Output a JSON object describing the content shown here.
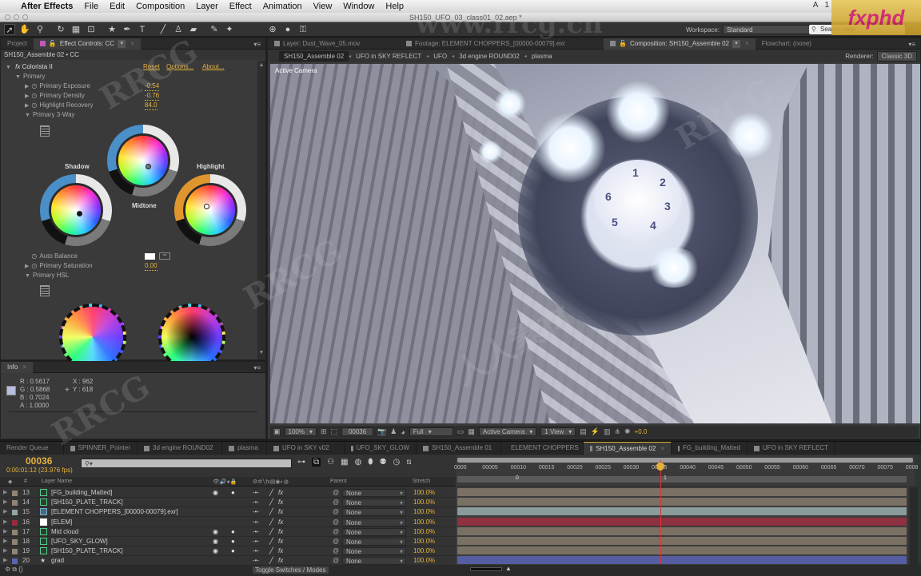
{
  "menubar": {
    "app": "After Effects",
    "items": [
      "File",
      "Edit",
      "Composition",
      "Layer",
      "Effect",
      "Animation",
      "View",
      "Window",
      "Help"
    ],
    "tray": [
      "A",
      "1"
    ]
  },
  "window": {
    "title": "SH150_UFO_03_class01_02.aep *"
  },
  "branding": {
    "logo": "fxphd"
  },
  "toolbar": {
    "tools": [
      "selection",
      "hand",
      "zoom",
      "rotate",
      "camera",
      "pan-behind",
      "shape",
      "pen",
      "type",
      "brush",
      "clone-stamp",
      "eraser",
      "roto-brush",
      "puppet-pin"
    ],
    "workspace_label": "Workspace:",
    "workspace_value": "Standard",
    "search_placeholder": "Search Help"
  },
  "effect_controls": {
    "tabs": [
      {
        "label": "Project"
      },
      {
        "label": "Effect Controls: CC",
        "active": true
      }
    ],
    "layer": "SH150_Assemble 02 • CC",
    "effect_name": "Colorista II",
    "links": {
      "reset": "Reset",
      "options": "Options...",
      "about": "About..."
    },
    "group_primary": "Primary",
    "props": [
      {
        "label": "Primary Exposure",
        "value": "-0.54"
      },
      {
        "label": "Primary Density",
        "value": "-0.76"
      },
      {
        "label": "Highlight Recovery",
        "value": "84.0"
      }
    ],
    "group_3way": "Primary 3-Way",
    "wheels": {
      "shadow": "Shadow",
      "midtone": "Midtone",
      "highlight": "Highlight"
    },
    "auto_balance": "Auto Balance",
    "primary_saturation": {
      "label": "Primary Saturation",
      "value": "0.00"
    },
    "group_hsl": "Primary HSL"
  },
  "info": {
    "tab": "Info",
    "r": "R : 0.5617",
    "g": "G : 0.5868",
    "b": "B : 0.7024",
    "a": "A : 1.0000",
    "x": "X : 962",
    "y": "Y : 618",
    "swatch_color": "#b9bde0"
  },
  "comp": {
    "tabs": [
      {
        "label": "Layer: Dust_Wave_05.mov"
      },
      {
        "label": "Footage: ELEMENT CHOPPERS_[00000-00079].exr"
      },
      {
        "label": "Composition: SH150_Assemble 02",
        "active": true
      },
      {
        "label": "Flowchart: (none)"
      }
    ],
    "breadcrumbs": [
      "SH150_Assemble 02",
      "UFO in SKY REFLECT",
      "UFO",
      "3d engine ROUND02",
      "plasma"
    ],
    "renderer_label": "Renderer:",
    "renderer_value": "Classic 3D",
    "viewport_label": "Active Camera",
    "clock_numbers": [
      "1",
      "2",
      "3",
      "4",
      "5",
      "6"
    ],
    "controls": {
      "zoom": "100%",
      "timecode": "00036",
      "resolution": "Full",
      "camera": "Active Camera",
      "views": "1 View",
      "exposure": "+0.0"
    }
  },
  "timeline": {
    "tabs": [
      {
        "label": "Render Queue"
      },
      {
        "label": "SPINNER_Pointer"
      },
      {
        "label": "3d engine ROUND02"
      },
      {
        "label": "plasma"
      },
      {
        "label": "UFO in SKY v02"
      },
      {
        "label": "UFO_SKY_GLOW"
      },
      {
        "label": "SH150_Assemble 01"
      },
      {
        "label": "ELEMENT CHOPPERS"
      },
      {
        "label": "SH150_Assemble 02",
        "active": true
      },
      {
        "label": "FG_building_Matted"
      },
      {
        "label": "UFO in SKY REFLECT"
      }
    ],
    "timecode": "00036",
    "fps": "0:00:01:12 (23.976 fps)",
    "search_placeholder": "",
    "columns": {
      "num": "#",
      "name": "Layer Name",
      "parent": "Parent",
      "stretch": "Stretch"
    },
    "ruler_ticks": [
      "0000",
      "00005",
      "00010",
      "00015",
      "00020",
      "00025",
      "00030",
      "00035",
      "00040",
      "00045",
      "00050",
      "00055",
      "00060",
      "00065",
      "00070",
      "00075",
      "0008"
    ],
    "markers": [
      "0",
      "1"
    ],
    "current_frame": 36,
    "layers": [
      {
        "num": "13",
        "name": "[FG_building_Matted]",
        "label_color": "#8f8474",
        "type": "comp",
        "visible": true,
        "parent": "None",
        "stretch": "100.0%",
        "bar_color": "#7a7064"
      },
      {
        "num": "14",
        "name": "[SH150_PLATE_TRACK]",
        "label_color": "#8f8474",
        "type": "comp",
        "visible": false,
        "parent": "None",
        "stretch": "100.0%",
        "bar_color": "#7a7064"
      },
      {
        "num": "15",
        "name": "[ELEMENT CHOPPERS_[00000-00079].exr]",
        "label_color": "#8fa6a4",
        "type": "footage",
        "visible": false,
        "parent": "None",
        "stretch": "100.0%",
        "bar_color": "#8a9c9c"
      },
      {
        "num": "16",
        "name": "[ELEM]",
        "label_color": "#9a2a3e",
        "type": "solid",
        "visible": false,
        "parent": "None",
        "stretch": "100.0%",
        "bar_color": "#8e3242"
      },
      {
        "num": "17",
        "name": "Mid cloud",
        "label_color": "#8f8474",
        "type": "comp",
        "visible": true,
        "parent": "None",
        "stretch": "100.0%",
        "bar_color": "#7a7064"
      },
      {
        "num": "18",
        "name": "[UFO_SKY_GLOW]",
        "label_color": "#8f8474",
        "type": "comp",
        "visible": true,
        "parent": "None",
        "stretch": "100.0%",
        "bar_color": "#7a7064"
      },
      {
        "num": "19",
        "name": "[SH150_PLATE_TRACK]",
        "label_color": "#8f8474",
        "type": "comp",
        "visible": true,
        "parent": "None",
        "stretch": "100.0%",
        "bar_color": "#7a7064"
      },
      {
        "num": "20",
        "name": "grad",
        "label_color": "#5a64b0",
        "type": "shape",
        "visible": false,
        "parent": "None",
        "stretch": "100.0%",
        "bar_color": "#545ea0"
      }
    ],
    "toggle_label": "Toggle Switches / Modes"
  },
  "watermarks": [
    "RRCG",
    "www.rrcg.cn",
    "人人素材"
  ]
}
